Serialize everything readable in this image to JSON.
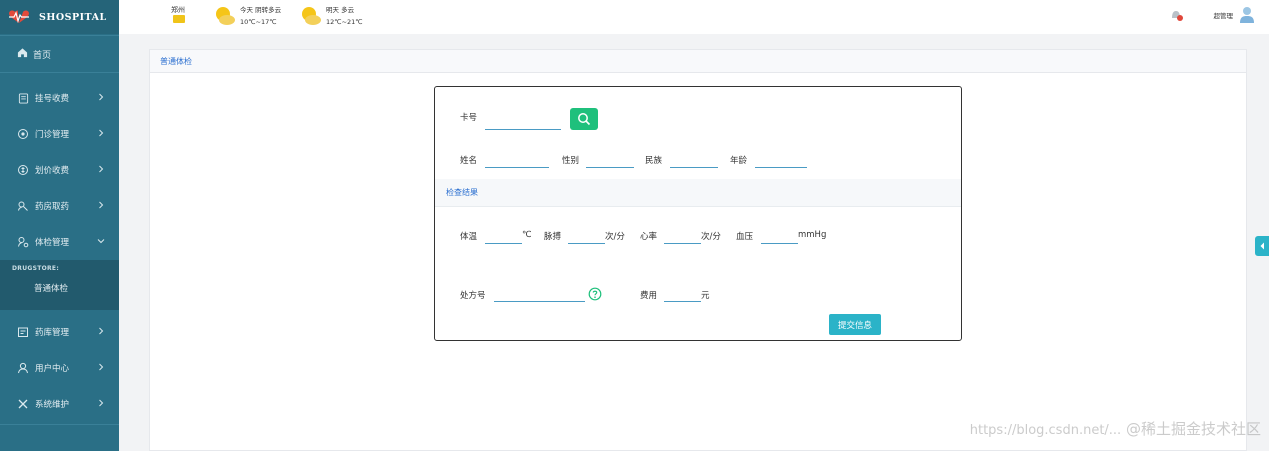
{
  "app": {
    "title": "SHOSPITAL"
  },
  "sidebar": {
    "home": "首页",
    "items": [
      {
        "label": "挂号收费",
        "icon": "register-icon"
      },
      {
        "label": "门诊管理",
        "icon": "clinic-icon"
      },
      {
        "label": "划价收费",
        "icon": "pricing-icon"
      },
      {
        "label": "药房取药",
        "icon": "pharmacy-icon"
      },
      {
        "label": "体检管理",
        "icon": "checkup-icon"
      }
    ],
    "submenu": {
      "heading": "DRUGSTORE:",
      "item": "普通体检"
    },
    "items_after": [
      {
        "label": "药库管理",
        "icon": "warehouse-icon"
      },
      {
        "label": "用户中心",
        "icon": "user-icon"
      },
      {
        "label": "系统维护",
        "icon": "tools-icon"
      }
    ]
  },
  "topbar": {
    "city": "郑州",
    "today": {
      "label": "今天  阴转多云",
      "temp": "10℃~17℃"
    },
    "tomorrow": {
      "label": "明天  多云",
      "temp": "12℃~21℃"
    },
    "admin": "超管理"
  },
  "page": {
    "tab": "普通体检"
  },
  "form": {
    "card_label": "卡号",
    "name_label": "姓名",
    "gender_label": "性别",
    "ethnicity_label": "民族",
    "age_label": "年龄",
    "section_title": "检查结果",
    "temp_label": "体温",
    "temp_unit": "℃",
    "pulse_label": "脉搏",
    "pulse_unit": "次/分",
    "heart_label": "心率",
    "heart_unit": "次/分",
    "bp_label": "血压",
    "bp_unit": "mmHg",
    "rx_label": "处方号",
    "fee_label": "费用",
    "fee_unit": "元",
    "submit": "提交信息"
  },
  "watermark": {
    "url": "https://blog.csdn.net/...",
    "brand": "@稀土掘金技术社区"
  },
  "colors": {
    "sidebar": "#2a6f86",
    "accent_green": "#1fc07c",
    "accent_teal": "#2bb3c8",
    "link_blue": "#2b6fd0"
  }
}
